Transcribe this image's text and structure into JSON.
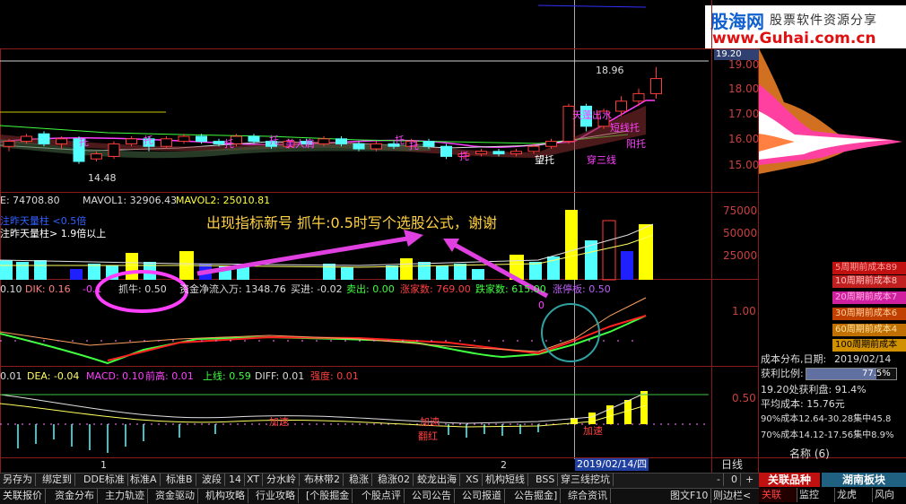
{
  "logo": {
    "brand": "股海网",
    "tagline": "股票软件资源分享",
    "url": "www.Guhai.com.cn"
  },
  "price_axis": {
    "current": "19.20",
    "ticks": [
      "19.00",
      "18.00",
      "17.00",
      "16.00",
      "15.00"
    ]
  },
  "vol_axis": {
    "ticks": [
      "75000",
      "50000",
      "25000"
    ]
  },
  "ind_axis": {
    "ticks": [
      "1.00"
    ]
  },
  "macd_axis": {
    "ticks": [
      "0.50"
    ]
  },
  "candle_annot": {
    "high": "18.96",
    "low": "14.48",
    "tags": [
      "托",
      "托",
      "托",
      "托",
      "托",
      "美人肩",
      "托",
      "托",
      "望托",
      "天蓬出水",
      "穿三线",
      "短线托",
      "阳托"
    ]
  },
  "vol_header": {
    "e": "E: 74708.80",
    "ma1": "MAVOL1: 32906.43",
    "ma2": "MAVOL2: 25010.81"
  },
  "vol_notes": {
    "line1": "注昨天量柱 <0.5倍",
    "line2": "注昨天量柱> 1.9倍以上"
  },
  "annotation": "出现指标新号 抓牛:0.5时写个选股公式，谢谢",
  "ind_header": {
    "v0": "0.10",
    "dik": "DIK: 0.16",
    "dik2": "-0.1",
    "zhuaniu": "抓牛: 0.50",
    "fund": "资金净流入万: 1348.76",
    "buy": "买进: -0.02",
    "sell": "卖出: 0.00",
    "up": "涨家数: 769.00",
    "down": "跌家数: 615.00",
    "limit": "涨停板: 0.50",
    "marker": "0"
  },
  "macd_header": {
    "v0": "0.01",
    "dea": "DEA: -0.04",
    "macd": "MACD: 0.10",
    "prev_high": "前高: 0.01",
    "upline": "上线: 0.59",
    "diff": "DIFF: 0.01",
    "strength": "强度: 0.01"
  },
  "macd_annot": [
    "加速",
    "加速",
    "翻红",
    "加速"
  ],
  "sidebar": {
    "cost_buttons": [
      "5周期前成本89",
      "10周期前成本8",
      "20周期前成本7",
      "30周期前成本6",
      "60周期前成本4",
      "100周期前成本"
    ],
    "cost_title": "成本分布,日期:",
    "cost_date": "2019/02/14",
    "profit_label": "获利比例:",
    "profit_value": "77.5%",
    "profit_line": "19.20处获利盘: 91.4%",
    "avg_cost": "平均成本: 15.76元",
    "c90": "90%成本12.64-30.28集中45.8",
    "c70": "70%成本14.12-17.56集中8.9%",
    "name_label": "名称 (6)",
    "tabs": [
      "关联品种",
      "湖南板块"
    ],
    "bottom": [
      "关联",
      "监控",
      "龙虎",
      "风向"
    ]
  },
  "time_axis": {
    "left": "1",
    "mid": "2",
    "date": "2019/02/14/四",
    "period": "日线"
  },
  "toolbar1": [
    "另存为",
    "绑定到",
    "DDE标准",
    "标准A",
    "标准B",
    "波段",
    "14",
    "XT",
    "分水岭",
    "布林带2",
    "稳涨",
    "稳涨02",
    "蛟龙出海",
    "XS",
    "机构短线",
    "BSS",
    "穿三线挖坑"
  ],
  "toolbar1_controls": [
    "-",
    "0",
    "+"
  ],
  "toolbar2": [
    "关联报价",
    "资金分布",
    "主力轨迹",
    "资金驱动",
    "机构攻略",
    "行业攻略",
    "[个股掘金",
    "个股点评",
    "公司公告",
    "公司报道",
    "公告掘金]",
    "综合资讯"
  ],
  "toolbar2_right": [
    "图文F10",
    "则边栏<"
  ],
  "colors": {
    "bg": "#000000",
    "grid": "#8a1c1c",
    "up": "#ff3c3c",
    "down": "#54ffff",
    "yellow": "#ffff00",
    "magenta": "#ff00ff",
    "annot": "#ffd040"
  }
}
